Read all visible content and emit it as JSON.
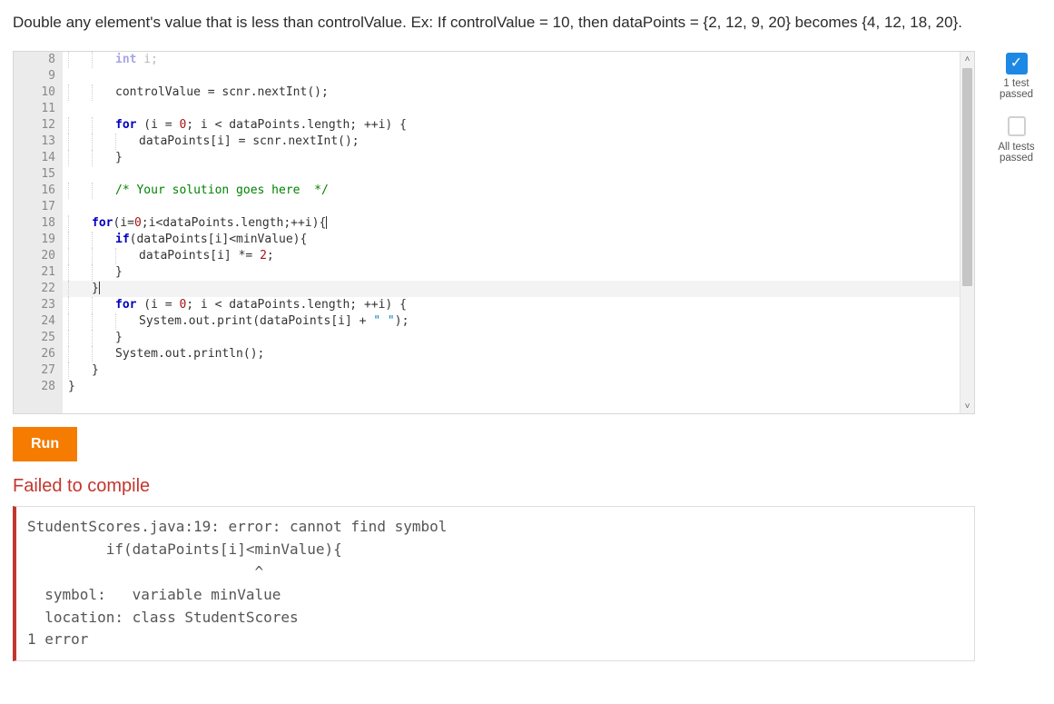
{
  "problem": {
    "text": "Double any element's value that is less than controlValue. Ex: If controlValue = 10, then dataPoints = {2, 12, 9, 20} becomes {4, 12, 18, 20}."
  },
  "editor": {
    "first_line_no": 8,
    "lines": [
      {
        "n": 8,
        "indent": 2,
        "html": "<span class='kw'>int</span> i;",
        "faded": true
      },
      {
        "n": 9,
        "indent": 0,
        "html": ""
      },
      {
        "n": 10,
        "indent": 2,
        "html": "controlValue = scnr.nextInt();"
      },
      {
        "n": 11,
        "indent": 0,
        "html": ""
      },
      {
        "n": 12,
        "indent": 2,
        "html": "<span class='kw'>for</span> (i = <span class='num'>0</span>; i &lt; dataPoints.length; ++i) {"
      },
      {
        "n": 13,
        "indent": 3,
        "html": "dataPoints[i] = scnr.nextInt();"
      },
      {
        "n": 14,
        "indent": 2,
        "html": "}"
      },
      {
        "n": 15,
        "indent": 0,
        "html": ""
      },
      {
        "n": 16,
        "indent": 2,
        "html": "<span class='cm'>/* Your solution goes here  */</span>"
      },
      {
        "n": 17,
        "indent": 0,
        "html": ""
      },
      {
        "n": 18,
        "indent": 1,
        "html": "<span class='kw'>for</span>(i=<span class='num'>0</span>;i&lt;dataPoints.length;++i){",
        "cursor": true
      },
      {
        "n": 19,
        "indent": 2,
        "html": "<span class='kw'>if</span>(dataPoints[i]&lt;minValue){"
      },
      {
        "n": 20,
        "indent": 3,
        "html": "dataPoints[i] *= <span class='num'>2</span>;"
      },
      {
        "n": 21,
        "indent": 2,
        "html": "}"
      },
      {
        "n": 22,
        "indent": 1,
        "html": "}",
        "highlight": true,
        "cursor_after": true
      },
      {
        "n": 23,
        "indent": 2,
        "html": "<span class='kw'>for</span> (i = <span class='num'>0</span>; i &lt; dataPoints.length; ++i) {"
      },
      {
        "n": 24,
        "indent": 3,
        "html": "System.out.print(dataPoints[i] + <span class='str'>\" \"</span>);"
      },
      {
        "n": 25,
        "indent": 2,
        "html": "}"
      },
      {
        "n": 26,
        "indent": 2,
        "html": "System.out.println();"
      },
      {
        "n": 27,
        "indent": 1,
        "html": "}"
      },
      {
        "n": 28,
        "indent": 0,
        "html": "}"
      }
    ]
  },
  "run_button_label": "Run",
  "result": {
    "title": "Failed to compile",
    "error_text": "StudentScores.java:19: error: cannot find symbol\n         if(dataPoints[i]<minValue){\n                          ^\n  symbol:   variable minValue\n  location: class StudentScores\n1 error"
  },
  "sidebar": {
    "test_passed_label": "1 test passed",
    "all_tests_label": "All tests passed"
  }
}
